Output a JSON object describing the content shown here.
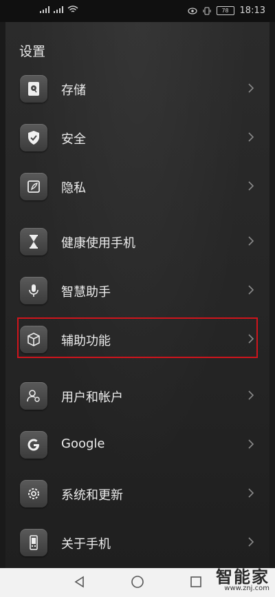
{
  "status_bar": {
    "time": "18:13",
    "battery_level": "78"
  },
  "page": {
    "title": "设置"
  },
  "settings": [
    {
      "label": "存储",
      "icon": "storage-icon"
    },
    {
      "label": "安全",
      "icon": "shield-check-icon"
    },
    {
      "label": "隐私",
      "icon": "privacy-note-icon"
    },
    {
      "label": "健康使用手机",
      "icon": "hourglass-icon"
    },
    {
      "label": "智慧助手",
      "icon": "microphone-icon"
    },
    {
      "label": "辅助功能",
      "icon": "accessibility-box-icon",
      "highlighted": true
    },
    {
      "label": "用户和帐户",
      "icon": "user-account-icon"
    },
    {
      "label": "Google",
      "icon": "google-icon"
    },
    {
      "label": "系统和更新",
      "icon": "system-gear-icon"
    },
    {
      "label": "关于手机",
      "icon": "phone-icon"
    }
  ],
  "navbar": {
    "back_icon": "back-triangle-icon",
    "home_icon": "home-circle-icon",
    "recents_icon": "recents-square-icon"
  },
  "watermark": {
    "text": "智能家",
    "url": "www.znj.com"
  },
  "colors": {
    "highlight": "#d0141c",
    "text": "#ececec"
  }
}
